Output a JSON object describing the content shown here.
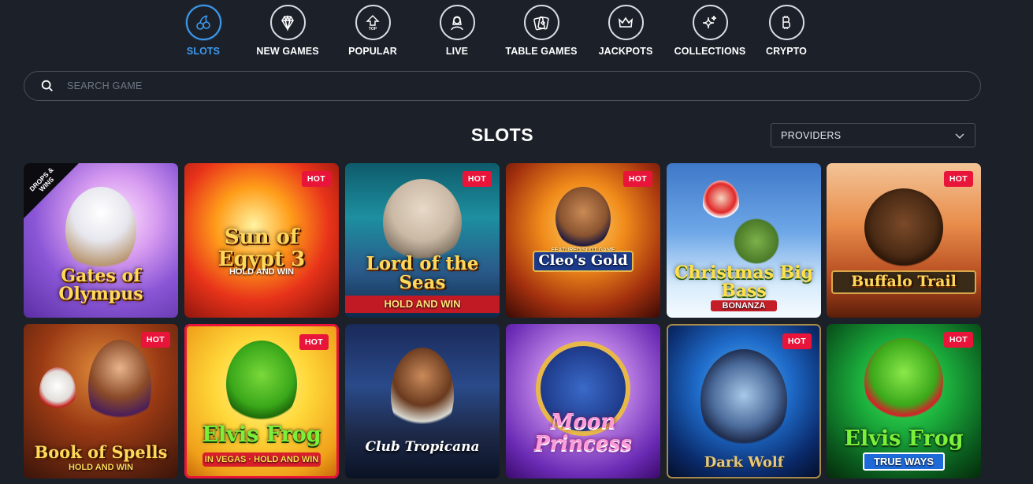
{
  "nav": {
    "items": [
      {
        "label": "SLOTS",
        "icon": "cherries-icon",
        "active": true
      },
      {
        "label": "NEW GAMES",
        "icon": "diamond-icon",
        "active": false
      },
      {
        "label": "POPULAR",
        "icon": "top-arrow-icon",
        "icon_text": "TOP",
        "active": false
      },
      {
        "label": "LIVE",
        "icon": "dealer-icon",
        "active": false
      },
      {
        "label": "TABLE GAMES",
        "icon": "cards-icon",
        "active": false
      },
      {
        "label": "JACKPOTS",
        "icon": "crown-icon",
        "active": false
      },
      {
        "label": "COLLECTIONS",
        "icon": "sparkles-icon",
        "active": false
      },
      {
        "label": "CRYPTO",
        "icon": "bitcoin-icon",
        "active": false
      }
    ]
  },
  "search": {
    "placeholder": "SEARCH GAME",
    "value": ""
  },
  "section": {
    "title": "SLOTS"
  },
  "providers": {
    "label": "PROVIDERS"
  },
  "badges": {
    "hot": "HOT",
    "ribbon": "DROPS & WINS"
  },
  "games": [
    {
      "name": "Gates of Olympus",
      "badge": "",
      "ribbon": true
    },
    {
      "name": "Sun of Egypt 3",
      "subtitle": "HOLD AND WIN",
      "badge": "HOT"
    },
    {
      "name": "Lord of the Seas",
      "subtitle": "HOLD AND WIN",
      "badge": "HOT"
    },
    {
      "name": "Cleo's Gold",
      "subtitle": "FEATURED SLOT GAME",
      "badge": "HOT"
    },
    {
      "name": "Christmas Big Bass",
      "subtitle": "BONANZA",
      "badge": ""
    },
    {
      "name": "Buffalo Trail",
      "badge": "HOT"
    },
    {
      "name": "Book of Spells",
      "subtitle": "HOLD AND WIN",
      "badge": "HOT"
    },
    {
      "name": "Elvis Frog",
      "subtitle": "IN VEGAS · HOLD AND WIN",
      "badge": "HOT"
    },
    {
      "name": "Club Tropicana",
      "badge": ""
    },
    {
      "name": "Moon Princess",
      "badge": ""
    },
    {
      "name": "Dark Wolf",
      "badge": "HOT"
    },
    {
      "name": "Elvis Frog",
      "subtitle": "TRUE WAYS",
      "badge": "HOT"
    }
  ],
  "colors": {
    "background": "#1b2029",
    "accent": "#3d9bf0",
    "hot_badge": "#e8143a",
    "border": "#4a505c"
  }
}
